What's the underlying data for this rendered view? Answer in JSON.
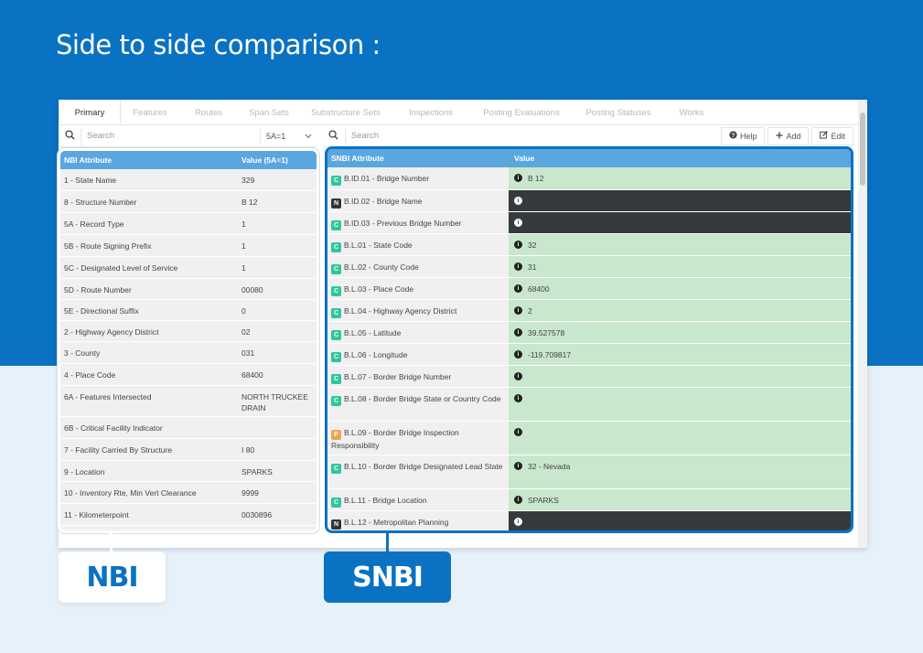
{
  "headline": "Side to side comparison :",
  "tabs": [
    "Primary",
    "Features",
    "Routes",
    "Span Sets",
    "Substructure Sets",
    "Inspections",
    "Posting Evaluations",
    "Posting Statuses",
    "Works"
  ],
  "toolbar": {
    "search_placeholder": "Search",
    "select_value": "5A=1",
    "help_label": "Help",
    "add_label": "Add",
    "edit_label": "Edit"
  },
  "nbi": {
    "header_attr": "NBI Attribute",
    "header_value": "Value (5A=1)",
    "rows": [
      {
        "attr": "1 - State Name",
        "value": "329"
      },
      {
        "attr": "8 - Structure Number",
        "value": "B 12"
      },
      {
        "attr": "5A - Record Type",
        "value": "1"
      },
      {
        "attr": "5B - Route Signing Prefix",
        "value": "1"
      },
      {
        "attr": "5C - Designated Level of Service",
        "value": "1"
      },
      {
        "attr": "5D - Route Number",
        "value": "00080"
      },
      {
        "attr": "5E - Directional Suffix",
        "value": "0"
      },
      {
        "attr": "2 - Highway Agency District",
        "value": "02"
      },
      {
        "attr": "3 - County",
        "value": "031"
      },
      {
        "attr": "4 - Place Code",
        "value": "68400"
      },
      {
        "attr": "6A - Features Intersected",
        "value": "NORTH TRUCKEE DRAIN"
      },
      {
        "attr": "6B - Critical Facility Indicator",
        "value": ""
      },
      {
        "attr": "7 - Facility Carried By Structure",
        "value": "I 80"
      },
      {
        "attr": "9 - Location",
        "value": "SPARKS"
      },
      {
        "attr": "10 - Inventory Rte, Min Vert Clearance",
        "value": "9999"
      },
      {
        "attr": "11 - Kilometerpoint",
        "value": "0030896"
      }
    ]
  },
  "snbi": {
    "header_attr": "SNBI Attribute",
    "header_value": "Value",
    "rows": [
      {
        "badge": "C",
        "attr": "B.ID.01 - Bridge Number",
        "value": "B 12",
        "style": "green"
      },
      {
        "badge": "N",
        "attr": "B.ID.02 - Bridge Name",
        "value": "",
        "style": "dark"
      },
      {
        "badge": "C",
        "attr": "B.ID.03 - Previous Bridge Number",
        "value": "",
        "style": "dark"
      },
      {
        "badge": "C",
        "attr": "B.L.01 - State Code",
        "value": "32",
        "style": "green"
      },
      {
        "badge": "C",
        "attr": "B.L.02 - County Code",
        "value": "31",
        "style": "green"
      },
      {
        "badge": "C",
        "attr": "B.L.03 - Place Code",
        "value": "68400",
        "style": "green"
      },
      {
        "badge": "C",
        "attr": "B.L.04 - Highway Agency District",
        "value": "2",
        "style": "green"
      },
      {
        "badge": "C",
        "attr": "B.L.05 - Latitude",
        "value": "39.527578",
        "style": "green"
      },
      {
        "badge": "C",
        "attr": "B.L.06 - Longitude",
        "value": "-119.709817",
        "style": "green"
      },
      {
        "badge": "C",
        "attr": "B.L.07 - Border Bridge Number",
        "value": "",
        "style": "green"
      },
      {
        "badge": "C",
        "attr": "B.L.08 - Border Bridge State or Country Code",
        "value": "",
        "style": "green"
      },
      {
        "badge": "P",
        "attr": "B.L.09 - Border Bridge Inspection Responsibility",
        "value": "",
        "style": "green"
      },
      {
        "badge": "C",
        "attr": "B.L.10 - Border Bridge Designated Lead State",
        "value": "32 - Nevada",
        "style": "green"
      },
      {
        "badge": "C",
        "attr": "B.L.11 - Bridge Location",
        "value": "SPARKS",
        "style": "green"
      },
      {
        "badge": "N",
        "attr": "B.L.12 - Metropolitan Planning",
        "value": "",
        "style": "dark"
      }
    ]
  },
  "labels": {
    "nbi": "NBI",
    "snbi": "SNBI"
  },
  "icons": {
    "search": "search-icon",
    "help": "question-circle-icon",
    "add": "plus-icon",
    "edit": "pencil-square-icon",
    "info": "info-circle-icon",
    "chevron": "chevron-down-icon"
  },
  "colors": {
    "brand_blue": "#0a72c2",
    "header_blue": "#5aa6df",
    "value_green": "#c9e7cc",
    "value_dark": "#363a3d",
    "badge_c": "#2ec5a0",
    "badge_n": "#353535",
    "badge_p": "#f0a44b"
  }
}
